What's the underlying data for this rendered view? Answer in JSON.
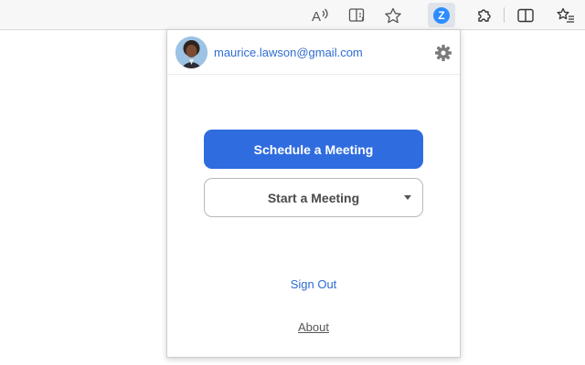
{
  "browser_toolbar": {
    "icons": [
      "read-aloud-icon",
      "immersive-reader-icon",
      "favorite-star-icon",
      "zoom-extension-icon",
      "extensions-puzzle-icon",
      "split-screen-icon",
      "favorites-list-icon"
    ],
    "zoom_badge_letter": "Z"
  },
  "popup": {
    "account_email": "maurice.lawson@gmail.com",
    "schedule_label": "Schedule a Meeting",
    "start_label": "Start a Meeting",
    "sign_out_label": "Sign Out",
    "about_label": "About"
  },
  "colors": {
    "primary": "#2f6ce0",
    "link": "#2e6cd1",
    "zoom_blue": "#2d8cff"
  }
}
